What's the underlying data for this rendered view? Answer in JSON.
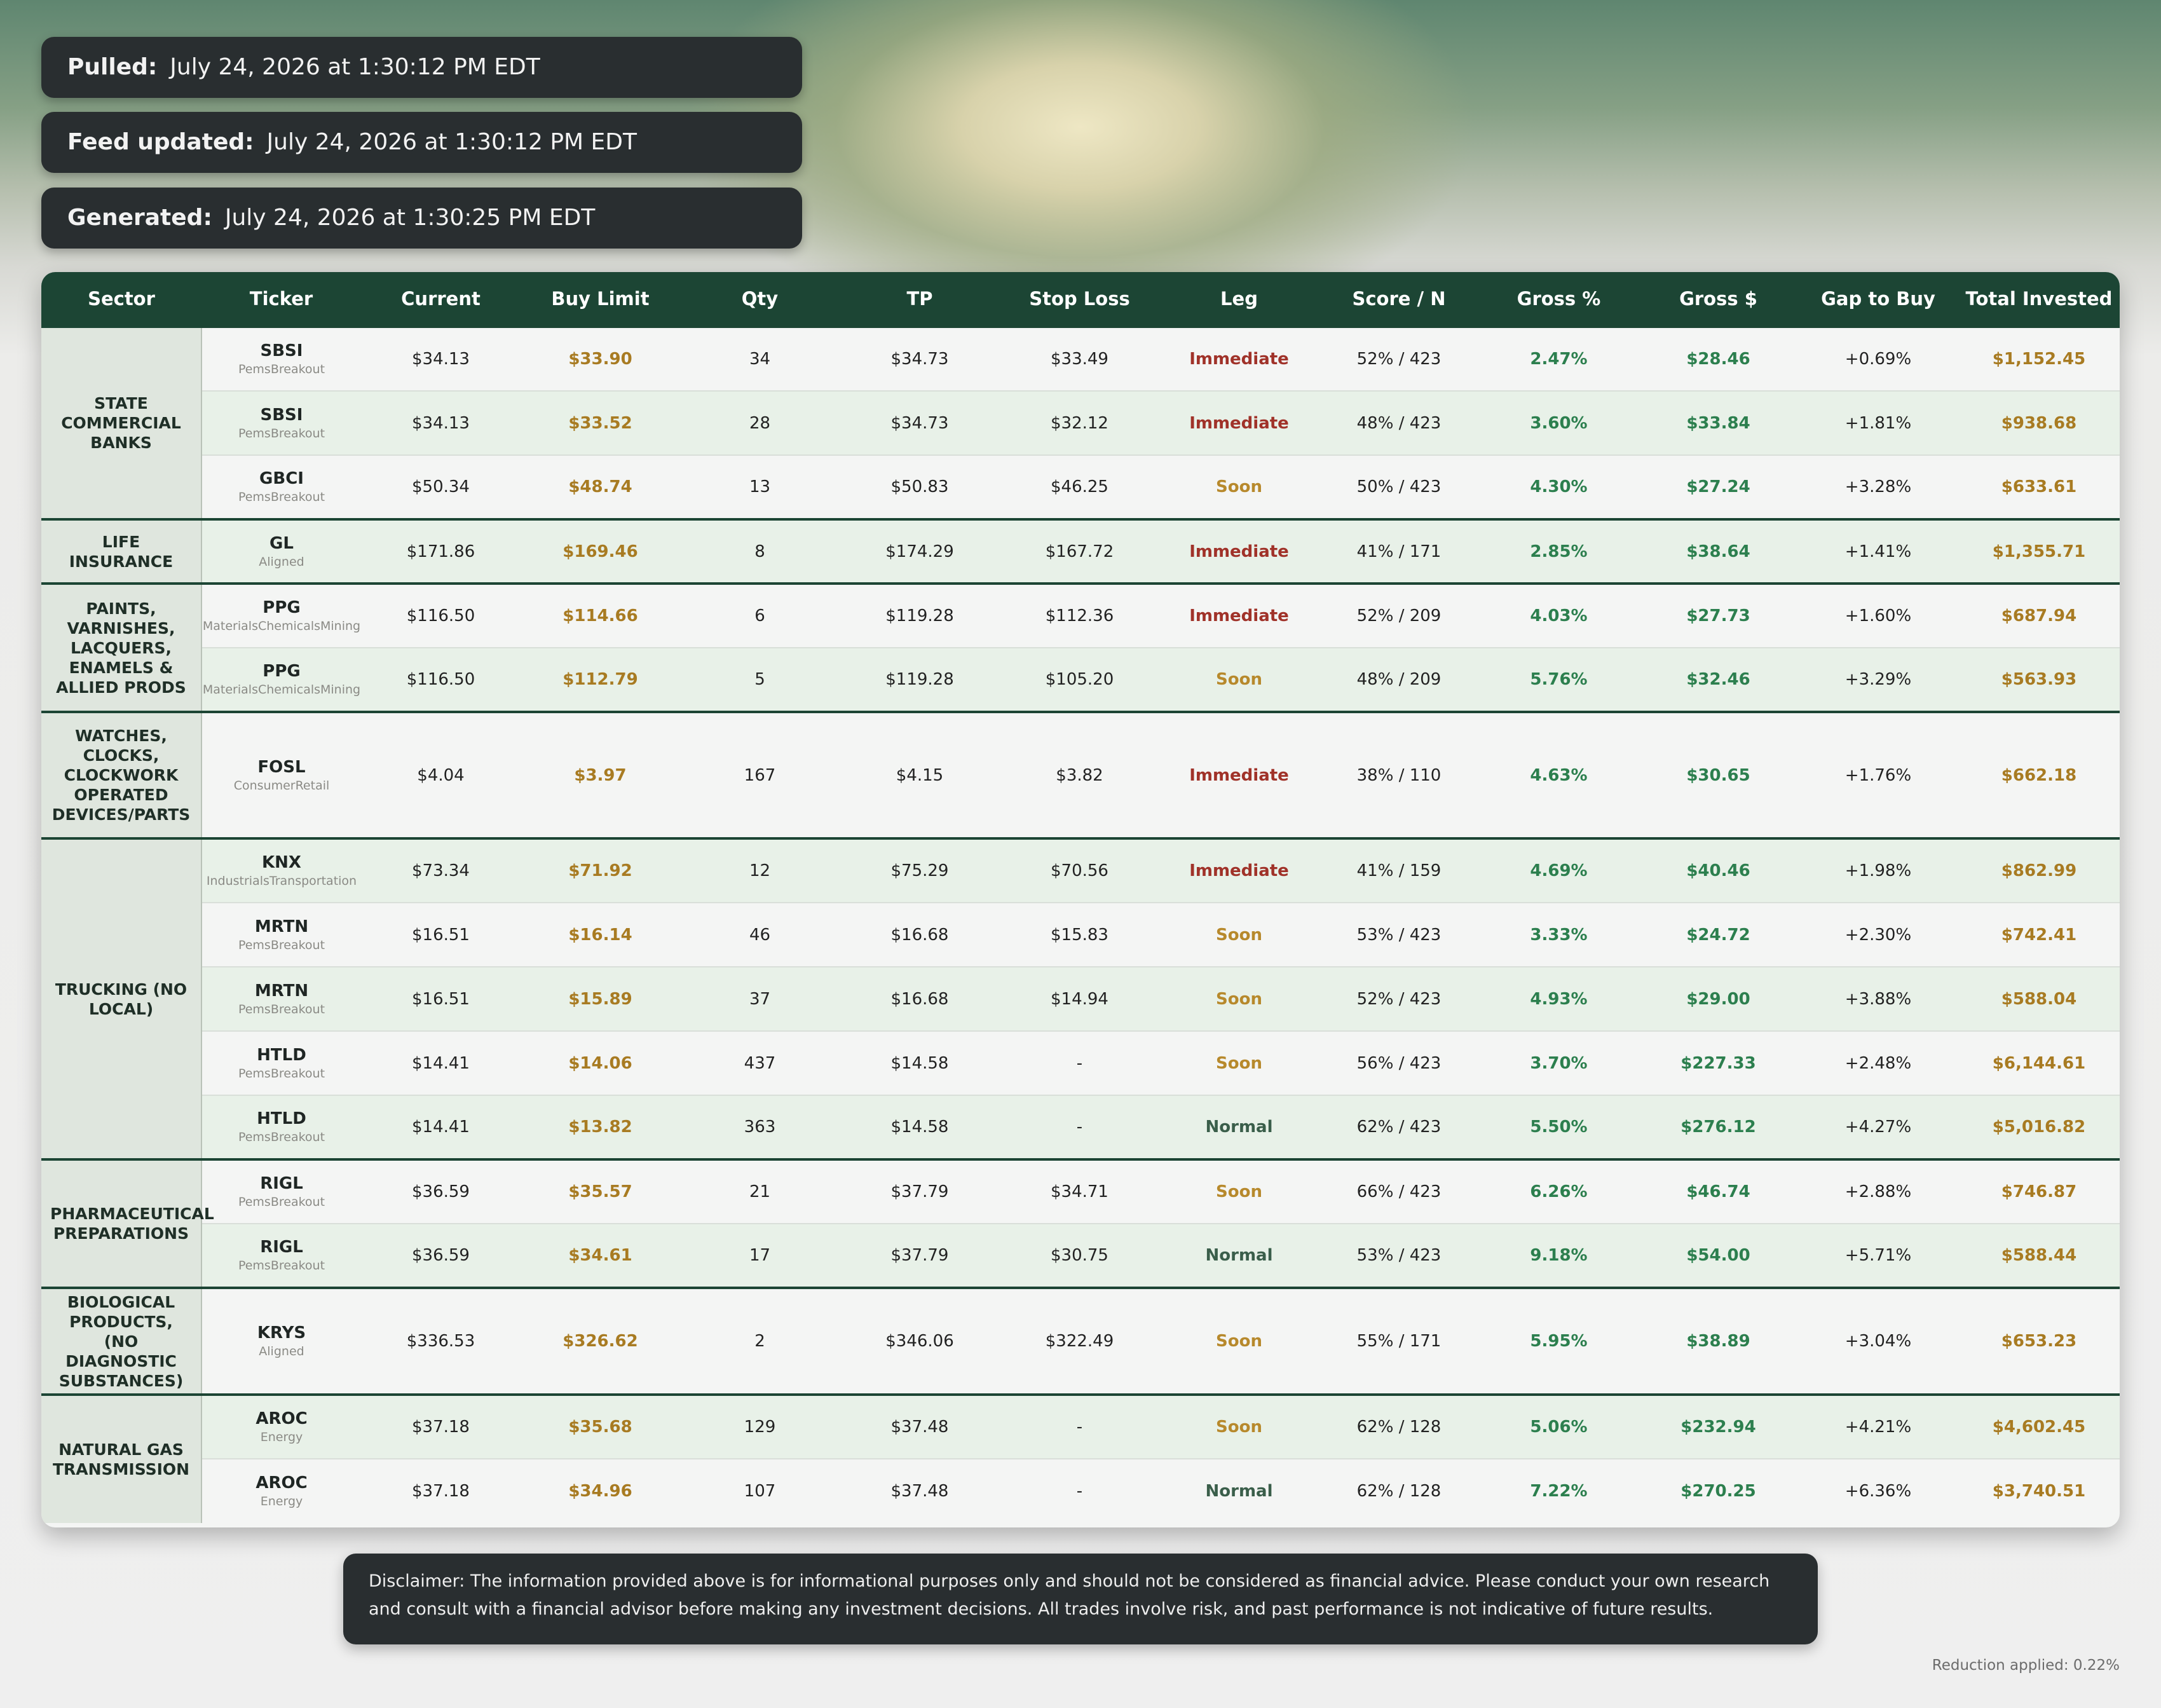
{
  "stamps": [
    {
      "label": "Pulled:",
      "value": "July 24, 2026 at 1:30:12 PM EDT"
    },
    {
      "label": "Feed updated:",
      "value": "July 24, 2026 at 1:30:12 PM EDT"
    },
    {
      "label": "Generated:",
      "value": "July 24, 2026 at 1:30:25 PM EDT"
    }
  ],
  "columns": [
    "Sector",
    "Ticker",
    "Current",
    "Buy Limit",
    "Qty",
    "TP",
    "Stop Loss",
    "Leg",
    "Score / N",
    "Gross %",
    "Gross $",
    "Gap to Buy",
    "Total Invested"
  ],
  "groups": [
    {
      "sector": "STATE COMMERCIAL BANKS",
      "rows": [
        {
          "ticker": "SBSI",
          "source": "PemsBreakout",
          "current": "$34.13",
          "buy_limit": "$33.90",
          "qty": "34",
          "tp": "$34.73",
          "stop_loss": "$33.49",
          "leg": "Immediate",
          "score": "52% / 423",
          "gross_pct": "2.47%",
          "gross_usd": "$28.46",
          "gap": "+0.69%",
          "total": "$1,152.45"
        },
        {
          "ticker": "SBSI",
          "source": "PemsBreakout",
          "current": "$34.13",
          "buy_limit": "$33.52",
          "qty": "28",
          "tp": "$34.73",
          "stop_loss": "$32.12",
          "leg": "Immediate",
          "score": "48% / 423",
          "gross_pct": "3.60%",
          "gross_usd": "$33.84",
          "gap": "+1.81%",
          "total": "$938.68"
        },
        {
          "ticker": "GBCI",
          "source": "PemsBreakout",
          "current": "$50.34",
          "buy_limit": "$48.74",
          "qty": "13",
          "tp": "$50.83",
          "stop_loss": "$46.25",
          "leg": "Soon",
          "score": "50% / 423",
          "gross_pct": "4.30%",
          "gross_usd": "$27.24",
          "gap": "+3.28%",
          "total": "$633.61"
        }
      ]
    },
    {
      "sector": "LIFE INSURANCE",
      "rows": [
        {
          "ticker": "GL",
          "source": "Aligned",
          "current": "$171.86",
          "buy_limit": "$169.46",
          "qty": "8",
          "tp": "$174.29",
          "stop_loss": "$167.72",
          "leg": "Immediate",
          "score": "41% / 171",
          "gross_pct": "2.85%",
          "gross_usd": "$38.64",
          "gap": "+1.41%",
          "total": "$1,355.71"
        }
      ]
    },
    {
      "sector": "PAINTS, VARNISHES, LACQUERS, ENAMELS & ALLIED PRODS",
      "rows": [
        {
          "ticker": "PPG",
          "source": "MaterialsChemicalsMining",
          "current": "$116.50",
          "buy_limit": "$114.66",
          "qty": "6",
          "tp": "$119.28",
          "stop_loss": "$112.36",
          "leg": "Immediate",
          "score": "52% / 209",
          "gross_pct": "4.03%",
          "gross_usd": "$27.73",
          "gap": "+1.60%",
          "total": "$687.94"
        },
        {
          "ticker": "PPG",
          "source": "MaterialsChemicalsMining",
          "current": "$116.50",
          "buy_limit": "$112.79",
          "qty": "5",
          "tp": "$119.28",
          "stop_loss": "$105.20",
          "leg": "Soon",
          "score": "48% / 209",
          "gross_pct": "5.76%",
          "gross_usd": "$32.46",
          "gap": "+3.29%",
          "total": "$563.93"
        }
      ]
    },
    {
      "sector": "WATCHES, CLOCKS, CLOCKWORK OPERATED DEVICES/PARTS",
      "rows": [
        {
          "ticker": "FOSL",
          "source": "ConsumerRetail",
          "current": "$4.04",
          "buy_limit": "$3.97",
          "qty": "167",
          "tp": "$4.15",
          "stop_loss": "$3.82",
          "leg": "Immediate",
          "score": "38% / 110",
          "gross_pct": "4.63%",
          "gross_usd": "$30.65",
          "gap": "+1.76%",
          "total": "$662.18"
        }
      ]
    },
    {
      "sector": "TRUCKING (NO LOCAL)",
      "rows": [
        {
          "ticker": "KNX",
          "source": "IndustrialsTransportation",
          "current": "$73.34",
          "buy_limit": "$71.92",
          "qty": "12",
          "tp": "$75.29",
          "stop_loss": "$70.56",
          "leg": "Immediate",
          "score": "41% / 159",
          "gross_pct": "4.69%",
          "gross_usd": "$40.46",
          "gap": "+1.98%",
          "total": "$862.99"
        },
        {
          "ticker": "MRTN",
          "source": "PemsBreakout",
          "current": "$16.51",
          "buy_limit": "$16.14",
          "qty": "46",
          "tp": "$16.68",
          "stop_loss": "$15.83",
          "leg": "Soon",
          "score": "53% / 423",
          "gross_pct": "3.33%",
          "gross_usd": "$24.72",
          "gap": "+2.30%",
          "total": "$742.41"
        },
        {
          "ticker": "MRTN",
          "source": "PemsBreakout",
          "current": "$16.51",
          "buy_limit": "$15.89",
          "qty": "37",
          "tp": "$16.68",
          "stop_loss": "$14.94",
          "leg": "Soon",
          "score": "52% / 423",
          "gross_pct": "4.93%",
          "gross_usd": "$29.00",
          "gap": "+3.88%",
          "total": "$588.04"
        },
        {
          "ticker": "HTLD",
          "source": "PemsBreakout",
          "current": "$14.41",
          "buy_limit": "$14.06",
          "qty": "437",
          "tp": "$14.58",
          "stop_loss": "-",
          "leg": "Soon",
          "score": "56% / 423",
          "gross_pct": "3.70%",
          "gross_usd": "$227.33",
          "gap": "+2.48%",
          "total": "$6,144.61"
        },
        {
          "ticker": "HTLD",
          "source": "PemsBreakout",
          "current": "$14.41",
          "buy_limit": "$13.82",
          "qty": "363",
          "tp": "$14.58",
          "stop_loss": "-",
          "leg": "Normal",
          "score": "62% / 423",
          "gross_pct": "5.50%",
          "gross_usd": "$276.12",
          "gap": "+4.27%",
          "total": "$5,016.82"
        }
      ]
    },
    {
      "sector": "PHARMACEUTICAL PREPARATIONS",
      "rows": [
        {
          "ticker": "RIGL",
          "source": "PemsBreakout",
          "current": "$36.59",
          "buy_limit": "$35.57",
          "qty": "21",
          "tp": "$37.79",
          "stop_loss": "$34.71",
          "leg": "Soon",
          "score": "66% / 423",
          "gross_pct": "6.26%",
          "gross_usd": "$46.74",
          "gap": "+2.88%",
          "total": "$746.87"
        },
        {
          "ticker": "RIGL",
          "source": "PemsBreakout",
          "current": "$36.59",
          "buy_limit": "$34.61",
          "qty": "17",
          "tp": "$37.79",
          "stop_loss": "$30.75",
          "leg": "Normal",
          "score": "53% / 423",
          "gross_pct": "9.18%",
          "gross_usd": "$54.00",
          "gap": "+5.71%",
          "total": "$588.44"
        }
      ]
    },
    {
      "sector": "BIOLOGICAL PRODUCTS, (NO DIAGNOSTIC SUBSTANCES)",
      "rows": [
        {
          "ticker": "KRYS",
          "source": "Aligned",
          "current": "$336.53",
          "buy_limit": "$326.62",
          "qty": "2",
          "tp": "$346.06",
          "stop_loss": "$322.49",
          "leg": "Soon",
          "score": "55% / 171",
          "gross_pct": "5.95%",
          "gross_usd": "$38.89",
          "gap": "+3.04%",
          "total": "$653.23"
        }
      ]
    },
    {
      "sector": "NATURAL GAS TRANSMISSION",
      "rows": [
        {
          "ticker": "AROC",
          "source": "Energy",
          "current": "$37.18",
          "buy_limit": "$35.68",
          "qty": "129",
          "tp": "$37.48",
          "stop_loss": "-",
          "leg": "Soon",
          "score": "62% / 128",
          "gross_pct": "5.06%",
          "gross_usd": "$232.94",
          "gap": "+4.21%",
          "total": "$4,602.45"
        },
        {
          "ticker": "AROC",
          "source": "Energy",
          "current": "$37.18",
          "buy_limit": "$34.96",
          "qty": "107",
          "tp": "$37.48",
          "stop_loss": "-",
          "leg": "Normal",
          "score": "62% / 128",
          "gross_pct": "7.22%",
          "gross_usd": "$270.25",
          "gap": "+6.36%",
          "total": "$3,740.51"
        }
      ]
    }
  ],
  "disclaimer": "Disclaimer: The information provided above is for informational purposes only and should not be considered as financial advice. Please conduct your own research and consult with a financial advisor before making any investment decisions. All trades involve risk, and past performance is not indicative of future results.",
  "reduction": "Reduction applied: 0.22%"
}
